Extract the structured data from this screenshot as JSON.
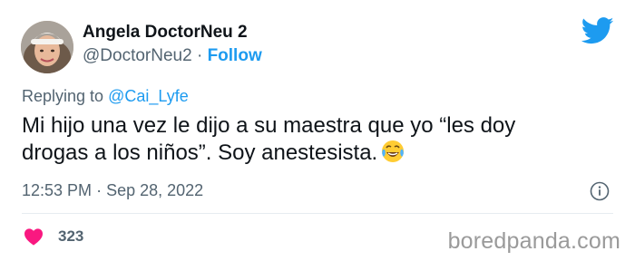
{
  "author": {
    "display_name": "Angela DoctorNeu 2",
    "handle": "@DoctorNeu2",
    "separator": "·",
    "follow_label": "Follow"
  },
  "reply": {
    "prefix": "Replying to",
    "mention": "@Cai_Lyfe"
  },
  "tweet": {
    "text": "Mi hijo una vez le dijo a su maestra que yo “les doy drogas a los niños”. Soy anestesista.",
    "emoji": "face-with-tears-of-joy"
  },
  "meta": {
    "time": "12:53 PM",
    "separator": "·",
    "date": "Sep 28, 2022"
  },
  "engagement": {
    "likes": "323"
  },
  "watermark": "boredpanda.com",
  "colors": {
    "accent": "#1d9bf0",
    "heart": "#f91880",
    "secondary_text": "#536471",
    "primary_text": "#0f1419"
  },
  "icons": [
    "twitter-bird-icon",
    "info-icon",
    "heart-icon",
    "face-with-tears-of-joy-emoji"
  ]
}
